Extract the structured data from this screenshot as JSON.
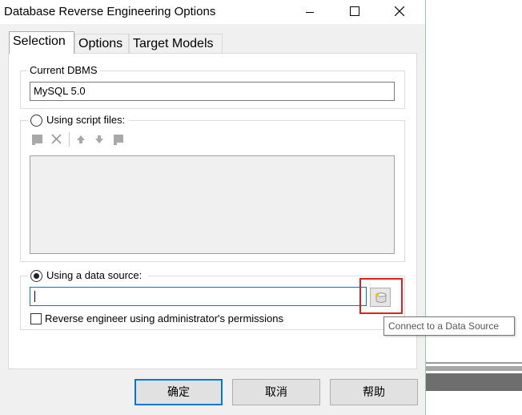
{
  "window": {
    "title": "Database Reverse Engineering Options"
  },
  "tabs": [
    {
      "label": "Selection",
      "active": true
    },
    {
      "label": "Options",
      "active": false
    },
    {
      "label": "Target Models",
      "active": false
    }
  ],
  "current_dbms": {
    "group_label": "Current DBMS",
    "value": "MySQL 5.0"
  },
  "script_files": {
    "radio_label": "Using script files:",
    "selected": false,
    "toolbar": [
      "add-file-icon",
      "delete-icon",
      "move-up-icon",
      "move-down-icon",
      "properties-icon"
    ]
  },
  "data_source": {
    "radio_label": "Using a data source:",
    "selected": true,
    "value": "",
    "connect_tooltip": "Connect to a Data Source",
    "admin_checkbox_label": "Reverse engineer using administrator's permissions",
    "admin_checked": false
  },
  "buttons": {
    "ok": "确定",
    "cancel": "取消",
    "help": "帮助"
  },
  "colors": {
    "highlight": "#e02020",
    "focus": "#0078d7"
  }
}
